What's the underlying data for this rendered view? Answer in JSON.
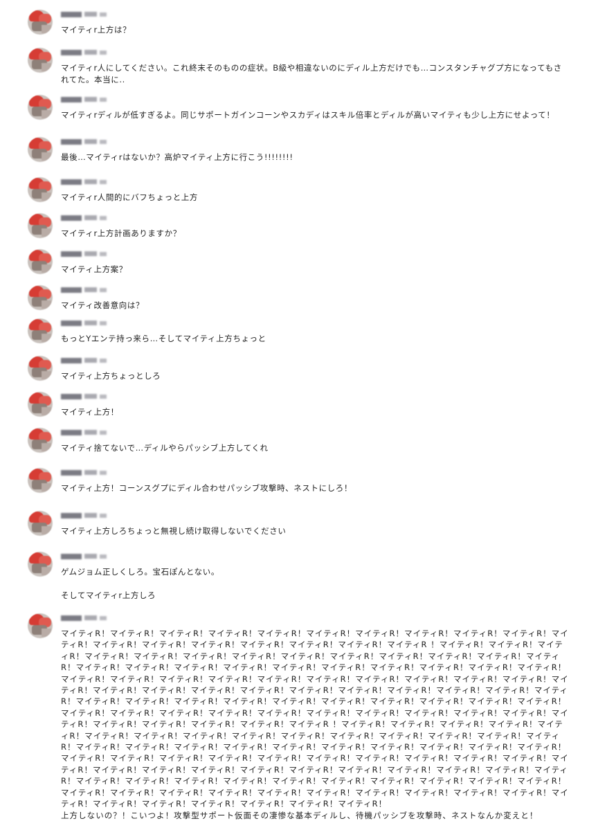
{
  "messages": [
    {
      "text": "マイティr上方は？"
    },
    {
      "text": "マイティr人にしてください。これ終末そのものの症状。B級や相違ないのにディル上方だけでも…コンスタンチャグプ方になってもされてた。本当に.."
    },
    {
      "text": "マイティrディルが低すぎるよ。同じサポートガインコーンやスカディはスキル倍率とディルが高いマイティも少し上方にせよって！"
    },
    {
      "text": "最後…マイティrはないか？高炉マイティ上方に行こう!!!!!!!!"
    },
    {
      "text": "マイティr人間的にバフちょっと上方"
    },
    {
      "text": "マイティr上方計画ありますか？"
    },
    {
      "text": "マイティ上方案？"
    },
    {
      "text": "マイティ改善意向は？"
    },
    {
      "text": "もっとYエンテ持っ来ら…そしてマイティ上方ちょっと"
    },
    {
      "text": "マイティ上方ちょっとしろ"
    },
    {
      "text": "マイティ上方！"
    },
    {
      "text": "マイティ捨てないで…ディルやらパッシブ上方してくれ"
    },
    {
      "text": "マイティ上方！コーンスグプにディル合わせパッシブ攻撃時、ネストにしろ！"
    },
    {
      "text": "マイティ上方しろちょっと無視し続け取得しないでください"
    },
    {
      "text": "ゲムジョム正しくしろ。宝石ぽんとない。",
      "extra": "そしてマイティr上方しろ"
    },
    {
      "text": "マイティR！マイティR！マイティR！マイティR！マイティR！マイティR！マイティR！マイティR！マイティR！マイティR！マイティR！マイティR！マイティR！マイティR！マイティR！マイティR！マイティR！マイティR ！マイティR！マイティR！マイティR！マイティR！マイティR！マイティR！マイティR！マイティR！マイティR！マイティR！マイティR！マイティR！マイティR！マイティR！マイティR！マイティR！マイティR！マイティR！マイティR！マイティR！マイティR！マイティR！マイティR！マイティR！マイティR！マイティR！マイティR！マイティR！マイティR！マイティR！マイティR！マイティR！マイティR！マイティR！マイティR！マイティR！マイティR！マイティR！マイティR！マイティR！マイティR！マイティR！マイティR！マイティR！マイティR！マイティR！マイティR！マイティR！マイティR！マイティR！マイティR！マイティR！マイティR！マイティR！マイティR！マイティR！マイティR！マイティR！マイティR！マイティR！マイティR！マイティR！マイティR！マイティR！マイティR！マイティR！マイティR！マイティR！マイティR！マイティR ！マイティR！マイティR！マイティR！マイティR！マイティR！マイティR！マイティR！マイティR！マイティR！マイティR！マイティR！マイティR！マイティR！マイティR！マイティR！マイティR！マイティR！マイティR！マイティR！マイティR！マイティR！マイティR！マイティR！マイティR！マイティR！マイティR！マイティR！マイティR！マイティR！マイティR！マイティR！マイティR！マイティR！マイティR！マイティR！マイティR！マイティR！マイティR！マイティR！マイティR！マイティR！マイティR！マイティR！マイティR！マイティR！マイティR！マイティR！マイティR！マイティR！マイティR！マイティR！マイティR！マイティR！マイティR！マイティR！マイティR！マイティR！マイティR！マイティR！マイティR！マイティR！マイティR！マイティR！マイティR！マイティR！マイティR！マイティR！マイティR！マイティR！マイティR！マイティR！マイティR！マイティR！\n上方しないの？！こいつよ！攻撃型サポート仮面その凄惨な基本ディルし、待機パッシブを攻撃時、ネストなんか変えと！"
    }
  ]
}
